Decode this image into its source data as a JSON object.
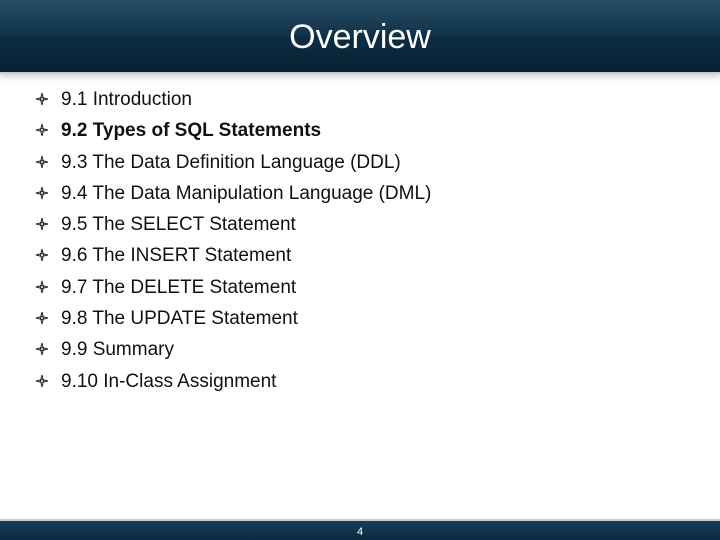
{
  "slide": {
    "title": "Overview",
    "page_number": "4"
  },
  "bullets": [
    {
      "text": "9.1 Introduction",
      "bold": false
    },
    {
      "text": "9.2 Types of SQL Statements",
      "bold": true
    },
    {
      "text": "9.3 The Data Definition Language (DDL)",
      "bold": false
    },
    {
      "text": "9.4 The Data Manipulation Language (DML)",
      "bold": false
    },
    {
      "text": "9.5 The SELECT Statement",
      "bold": false
    },
    {
      "text": "9.6 The INSERT Statement",
      "bold": false
    },
    {
      "text": "9.7 The DELETE Statement",
      "bold": false
    },
    {
      "text": "9.8 The UPDATE Statement",
      "bold": false
    },
    {
      "text": "9.9 Summary",
      "bold": false
    },
    {
      "text": "9.10 In-Class Assignment",
      "bold": false
    }
  ],
  "colors": {
    "title_bar": "#0b2f46",
    "text": "#111111"
  },
  "icons": {
    "bullet_marker": "diamond-bullet-icon"
  }
}
